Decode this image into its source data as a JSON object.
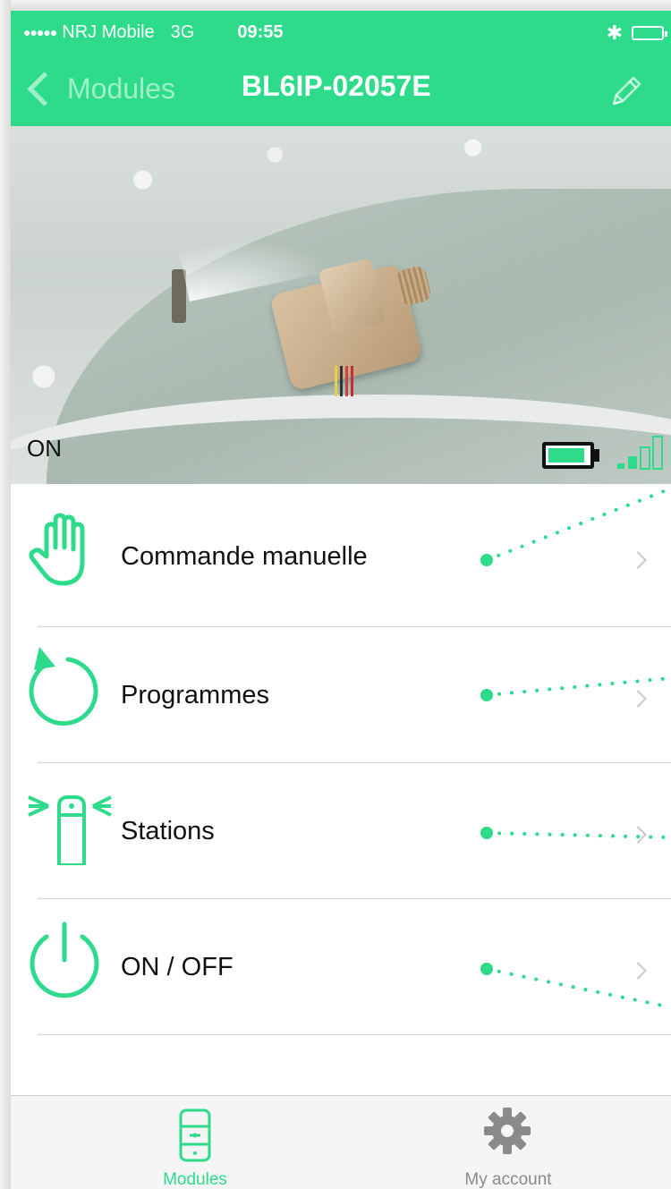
{
  "status_bar": {
    "signal_dots": "●●●●●",
    "carrier": "NRJ Mobile",
    "network": "3G",
    "time": "09:55",
    "bluetooth_icon": "bluetooth-icon",
    "battery_icon": "battery-icon"
  },
  "nav": {
    "back_label": "Modules",
    "title": "BL6IP-02057E",
    "edit_icon": "pencil-icon"
  },
  "hero": {
    "state": "ON",
    "battery_level": 0.9,
    "signal_bars": 2
  },
  "menu": {
    "items": [
      {
        "label": "Commande manuelle",
        "icon": "hand-icon"
      },
      {
        "label": "Programmes",
        "icon": "cycle-arrow-icon"
      },
      {
        "label": "Stations",
        "icon": "station-valve-icon"
      },
      {
        "label": "ON / OFF",
        "icon": "power-icon"
      }
    ]
  },
  "tabbar": {
    "tabs": [
      {
        "label": "Modules",
        "icon": "module-device-icon",
        "active": true
      },
      {
        "label": "My account",
        "icon": "gear-icon",
        "active": false
      }
    ]
  },
  "colors": {
    "accent": "#2ddb8a",
    "inactive": "#8a8a8a"
  }
}
